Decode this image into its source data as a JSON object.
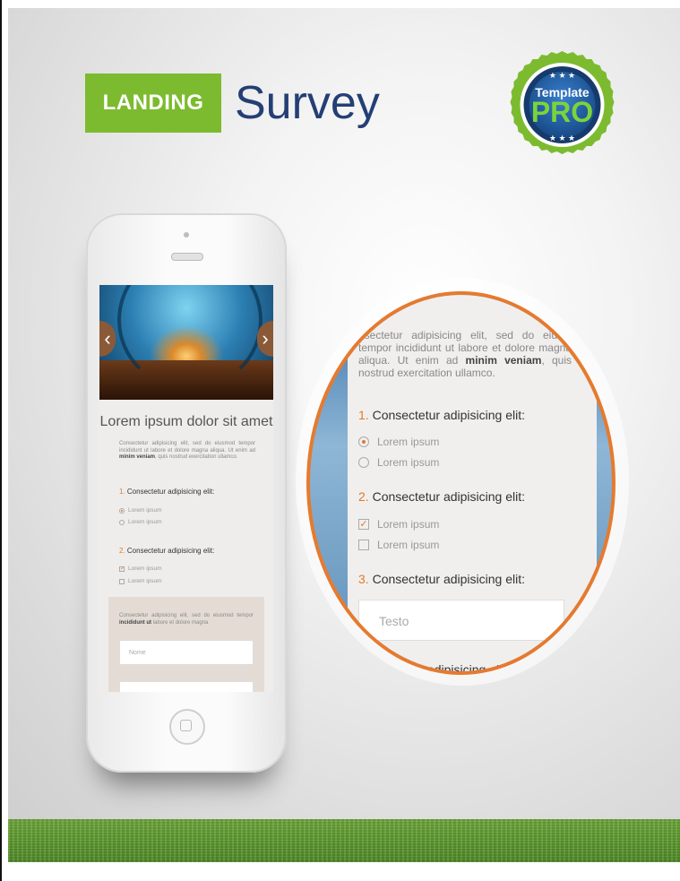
{
  "brand": {
    "box_label": "LANDING",
    "word": "Survey",
    "green": "#7cbb2f",
    "navy": "#243f74"
  },
  "badge": {
    "top_text": "Template",
    "main_text": "PRO",
    "ring_color": "#7cbb2f",
    "inner_color": "#1f5fa8"
  },
  "phone": {
    "title": "Lorem ipsum dolor sit amet",
    "intro_a": "Consectetur adipisicing elit, sed do eiusmod tempor incididunt ut labore et dolore magna aliqua. Ut enim ad ",
    "intro_bold1": "minim",
    "intro_mid": " ",
    "intro_bold2": "veniam",
    "intro_b": ", quis nostrud exercitation ullamco.",
    "q1_num": "1.",
    "q1_text": "Consectetur adipisicing elit:",
    "q1_opt1": "Lorem ipsum",
    "q1_opt2": "Lorem ipsum",
    "q2_num": "2.",
    "q2_text": "Consectetur adipisicing elit:",
    "q2_opt1": "Lorem ipsum",
    "q2_opt2": "Lorem ipsum",
    "box_a": "Consectetur adipisicing elit, sed do eiusmod tempor ",
    "box_bold1": "incididunt",
    "box_mid": " ",
    "box_bold2": "ut",
    "box_b": " labore et dolore magna",
    "field_placeholder": "Nome"
  },
  "zoom": {
    "intro_a": "nsectetur adipisicing elit, sed do eiusm tempor incididunt ut labore et dolore magna aliqua. Ut enim ad ",
    "intro_bold1": "minim",
    "intro_mid": " ",
    "intro_bold2": "veniam",
    "intro_b": ", quis nostrud exercitation ullamco.",
    "q1_num": "1.",
    "q1_text": "Consectetur adipisicing elit:",
    "q1_opt1": "Lorem ipsum",
    "q1_opt2": "Lorem ipsum",
    "q2_num": "2.",
    "q2_text": "Consectetur adipisicing elit:",
    "q2_opt1": "Lorem ipsum",
    "q2_opt2": "Lorem ipsum",
    "q3_num": "3.",
    "q3_text": "Consectetur adipisicing elit:",
    "field_placeholder": "Testo",
    "q4_partial": "ctetur adipisicing elit:",
    "accent": "#e67a2e"
  },
  "icons": {
    "slider_left": "chevron-left-icon",
    "slider_right": "chevron-right-icon",
    "home_button": "home-button-icon"
  }
}
